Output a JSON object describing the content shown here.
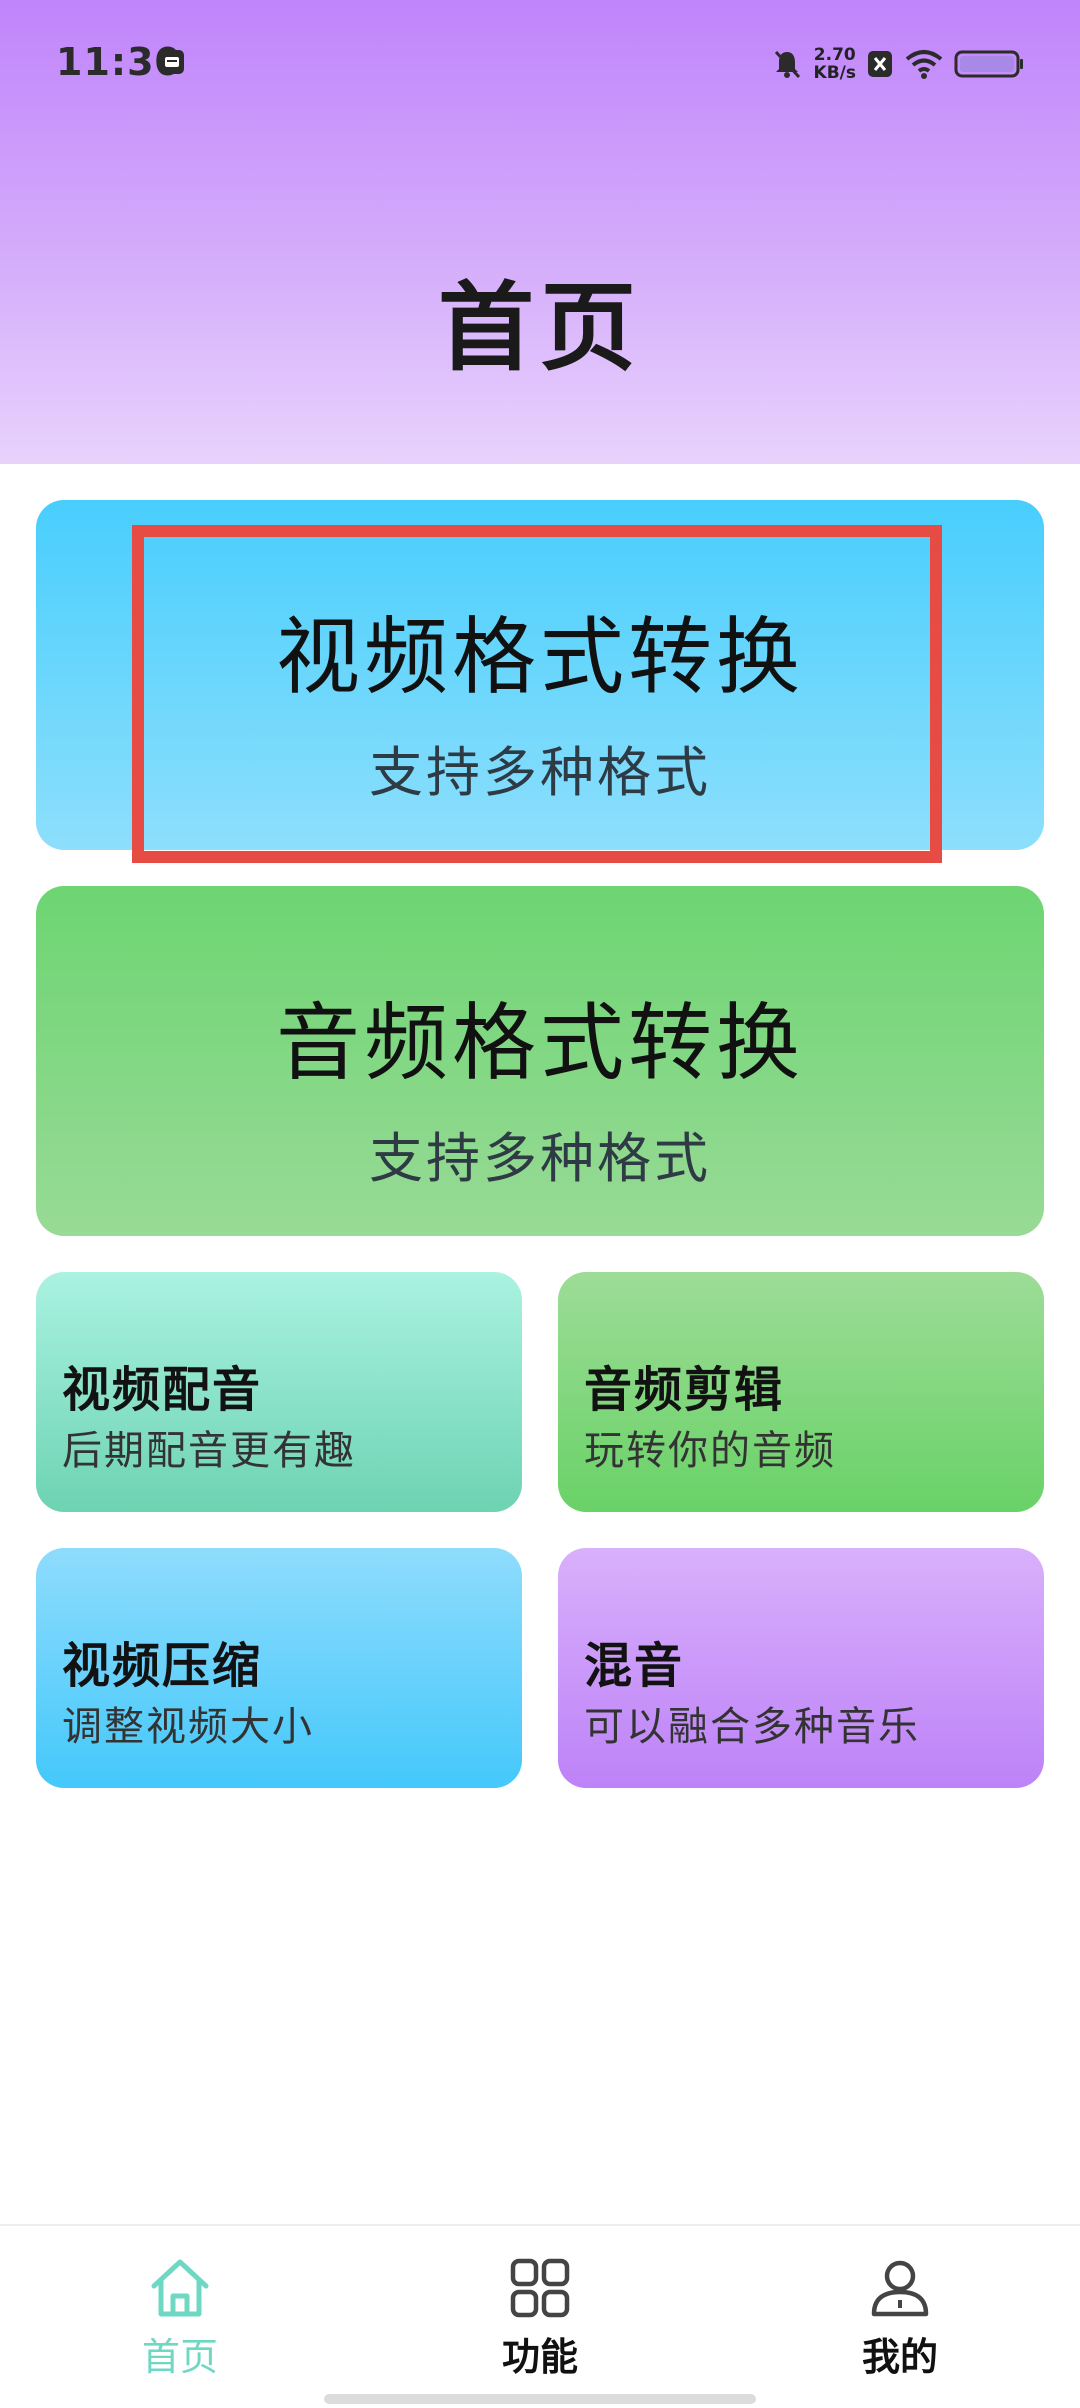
{
  "status_bar": {
    "time": "11:30",
    "speed_value": "2.70",
    "speed_unit": "KB/s"
  },
  "header": {
    "title": "首页"
  },
  "cards": {
    "video_format": {
      "title": "视频格式转换",
      "subtitle": "支持多种格式"
    },
    "audio_format": {
      "title": "音频格式转换",
      "subtitle": "支持多种格式"
    },
    "video_dub": {
      "title": "视频配音",
      "subtitle": "后期配音更有趣"
    },
    "audio_cut": {
      "title": "音频剪辑",
      "subtitle": "玩转你的音频"
    },
    "video_compress": {
      "title": "视频压缩",
      "subtitle": "调整视频大小"
    },
    "mix": {
      "title": "混音",
      "subtitle": "可以融合多种音乐"
    }
  },
  "bottom_nav": {
    "items": [
      {
        "label": "首页",
        "icon": "home-icon",
        "active": true
      },
      {
        "label": "功能",
        "icon": "grid-icon",
        "active": false
      },
      {
        "label": "我的",
        "icon": "user-icon",
        "active": false
      }
    ]
  },
  "colors": {
    "header_top": "#c084fb",
    "highlight": "#e74c44",
    "active_nav": "#6fd8c4"
  }
}
